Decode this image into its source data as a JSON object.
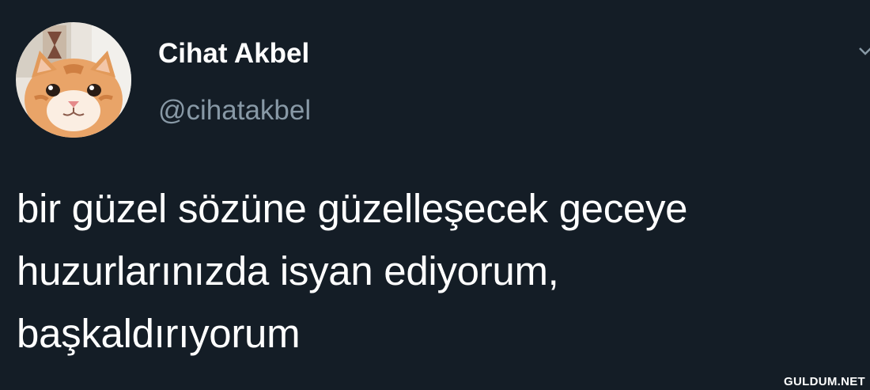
{
  "tweet": {
    "author": {
      "name": "Cihat Akbel",
      "handle": "@cihatakbel"
    },
    "text_lines": [
      "bir güzel sözüne güzelleşecek geceye",
      "huzurlarınızda isyan ediyorum,",
      "başkaldırıyorum"
    ]
  },
  "watermark": "GULDUM.NET",
  "colors": {
    "background": "#141d26",
    "text": "#ffffff",
    "handle": "#8899a6"
  },
  "icons": {
    "avatar": "cat-avatar",
    "menu": "chevron-down-icon"
  }
}
